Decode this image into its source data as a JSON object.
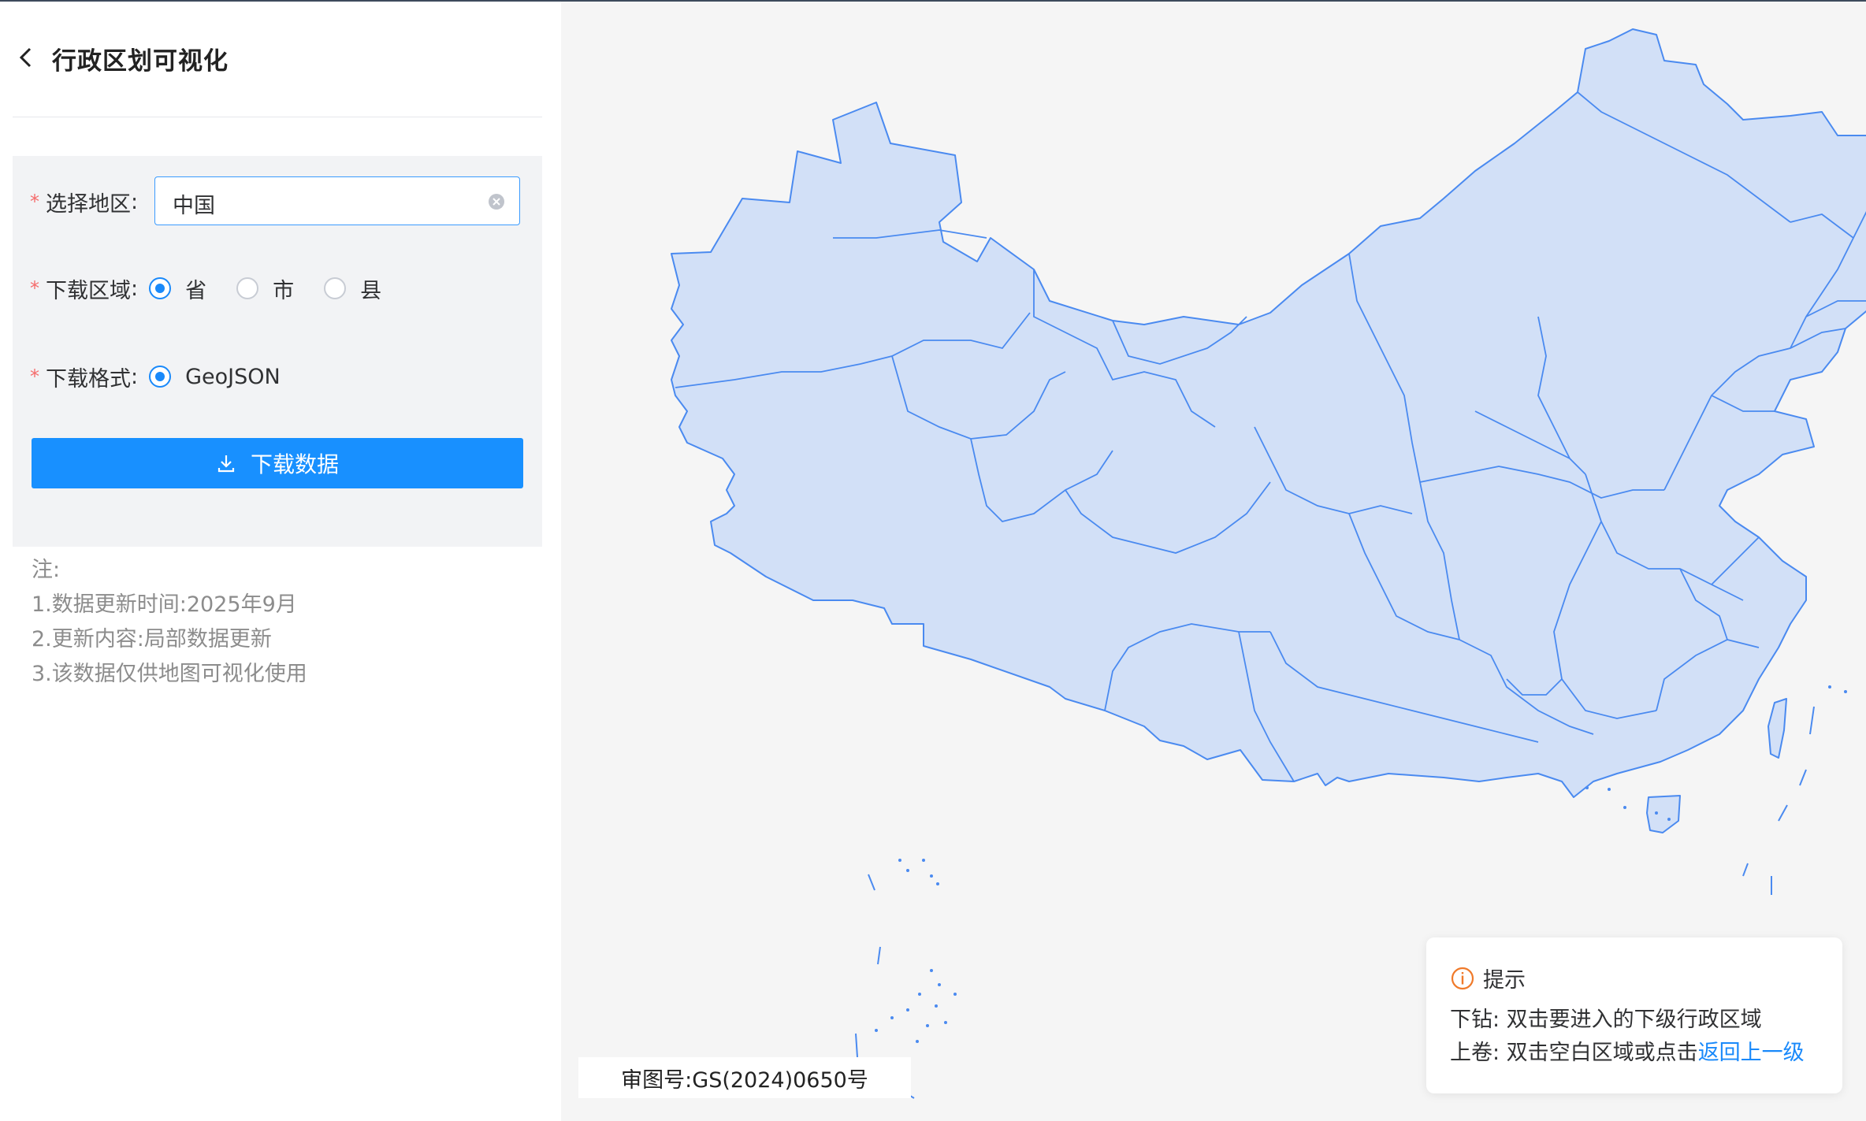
{
  "header": {
    "title": "行政区划可视化"
  },
  "form": {
    "region_label": "选择地区",
    "region_value": "中国",
    "area_label": "下载区域",
    "area_options": [
      "省",
      "市",
      "县"
    ],
    "area_selected": "省",
    "format_label": "下载格式",
    "format_options": [
      "GeoJSON"
    ],
    "format_selected": "GeoJSON",
    "colon": ":",
    "required_mark": "*",
    "download_button": "下载数据"
  },
  "notes": {
    "title": "注:",
    "items": [
      "1.数据更新时间:2025年9月",
      "2.更新内容:局部数据更新",
      "3.该数据仅供地图可视化使用"
    ]
  },
  "map": {
    "approval_number": "审图号:GS(2024)0650号",
    "fill_color": "#d2e0f7",
    "stroke_color": "#4a8af0"
  },
  "tip": {
    "title": "提示",
    "drill_down": "下钻: 双击要进入的下级行政区域",
    "roll_up_prefix": "上卷: 双击空白区域或点击",
    "roll_up_link": "返回上一级"
  },
  "icons": {
    "back": "chevron-left-icon",
    "clear": "clear-circle-icon",
    "download": "download-icon",
    "info": "info-icon"
  }
}
